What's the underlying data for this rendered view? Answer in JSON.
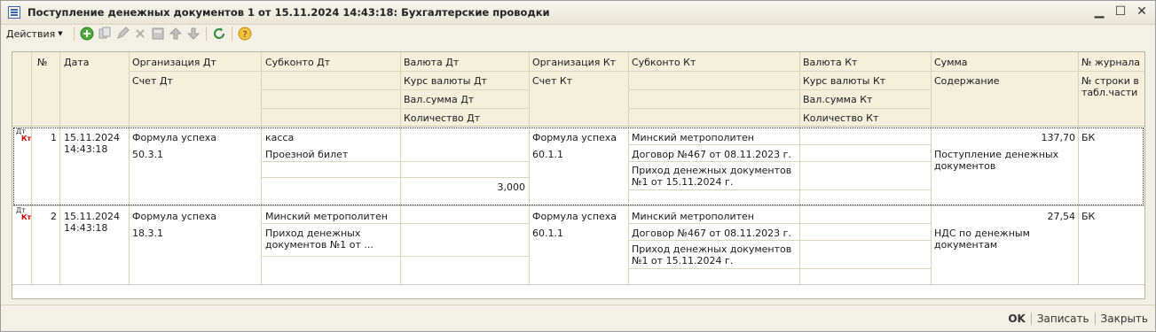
{
  "window": {
    "title": "Поступление денежных документов 1 от 15.11.2024 14:43:18: Бухгалтерские проводки",
    "minimize": "▁",
    "maximize": "☐",
    "close": "✕"
  },
  "toolbar": {
    "actions_label": "Действия",
    "icons": [
      "add-icon",
      "copy-icon",
      "edit-icon",
      "delete-icon",
      "post-icon",
      "move-up-icon",
      "move-down-icon",
      "refresh-icon",
      "help-icon"
    ]
  },
  "header": {
    "num": "№",
    "date": "Дата",
    "org_dt": "Организация Дт",
    "acc_dt": "Счет Дт",
    "subconto_dt": "Субконто Дт",
    "currency_dt": "Валюта Дт",
    "rate_dt": "Курс валюты Дт",
    "cur_sum_dt": "Вал.сумма Дт",
    "qty_dt": "Количество Дт",
    "org_kt": "Организация Кт",
    "acc_kt": "Счет Кт",
    "subconto_kt": "Субконто Кт",
    "currency_kt": "Валюта Кт",
    "rate_kt": "Курс валюты Кт",
    "cur_sum_kt": "Вал.сумма Кт",
    "qty_kt": "Количество Кт",
    "sum": "Сумма",
    "content": "Содержание",
    "journal": "№ журнала",
    "line_no": "№ строки в табл.части"
  },
  "rows": [
    {
      "type_dt": "Дт",
      "type_kt": "Кт",
      "num": "1",
      "date": "15.11.2024",
      "time": "14:43:18",
      "org_dt": "Формула успеха",
      "acc_dt": "50.3.1",
      "subconto_dt_1": "касса",
      "subconto_dt_2": "Проезной билет",
      "qty_dt": "3,000",
      "org_kt": "Формула успеха",
      "acc_kt": "60.1.1",
      "subconto_kt_1": "Минский метрополитен",
      "subconto_kt_2": "Договор №467 от 08.11.2023 г.",
      "subconto_kt_3": "Приход денежных документов №1 от 15.11.2024 г.",
      "sum": "137,70",
      "content": "Поступление денежных документов",
      "journal": "БК"
    },
    {
      "type_dt": "Дт",
      "type_kt": "Кт",
      "num": "2",
      "date": "15.11.2024",
      "time": "14:43:18",
      "org_dt": "Формула успеха",
      "acc_dt": "18.3.1",
      "subconto_dt_1": "Минский метрополитен",
      "subconto_dt_2": "Приход денежных документов №1 от ...",
      "qty_dt": "",
      "org_kt": "Формула успеха",
      "acc_kt": "60.1.1",
      "subconto_kt_1": "Минский метрополитен",
      "subconto_kt_2": "Договор №467 от 08.11.2023 г.",
      "subconto_kt_3": "Приход денежных документов №1 от 15.11.2024 г.",
      "sum": "27,54",
      "content": "НДС по денежным документам",
      "journal": "БК"
    }
  ],
  "footer": {
    "ok": "OK",
    "save": "Записать",
    "close": "Закрыть"
  }
}
